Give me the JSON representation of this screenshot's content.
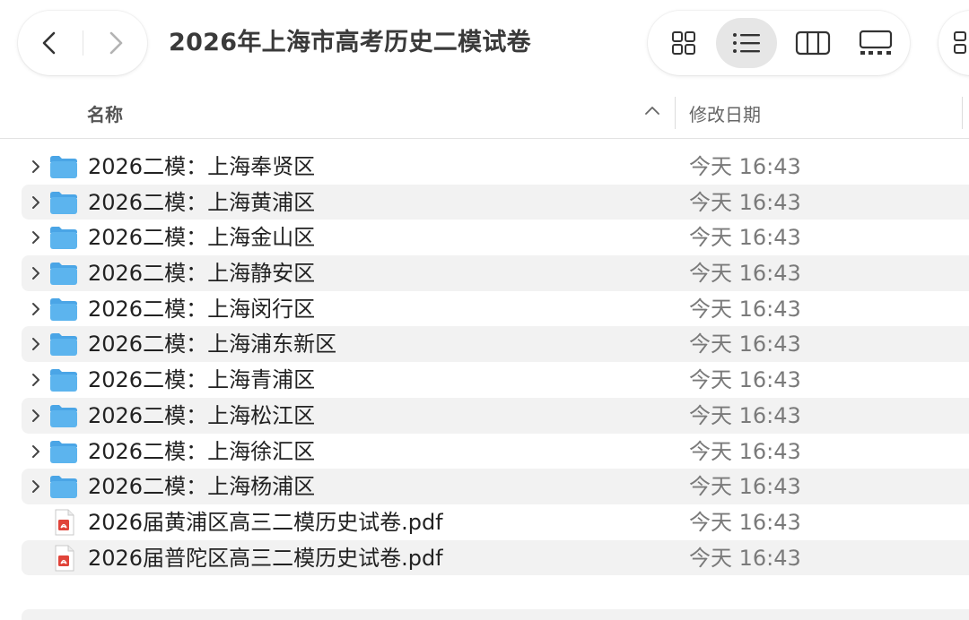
{
  "toolbar": {
    "title": "2026年上海市高考历史二模试卷",
    "back_icon": "chevron-left-icon",
    "forward_icon": "chevron-right-icon",
    "view_modes": [
      "icon-view",
      "list-view",
      "column-view",
      "gallery-view"
    ],
    "active_view": "list-view"
  },
  "columns": {
    "name": "名称",
    "date_modified": "修改日期",
    "sort_icon": "chevron-up-icon"
  },
  "files": [
    {
      "name": "2026二模：上海奉贤区",
      "date": "今天 16:43",
      "kind": "folder"
    },
    {
      "name": "2026二模：上海黄浦区",
      "date": "今天 16:43",
      "kind": "folder"
    },
    {
      "name": "2026二模：上海金山区",
      "date": "今天 16:43",
      "kind": "folder"
    },
    {
      "name": "2026二模：上海静安区",
      "date": "今天 16:43",
      "kind": "folder"
    },
    {
      "name": "2026二模：上海闵行区",
      "date": "今天 16:43",
      "kind": "folder"
    },
    {
      "name": "2026二模：上海浦东新区",
      "date": "今天 16:43",
      "kind": "folder"
    },
    {
      "name": "2026二模：上海青浦区",
      "date": "今天 16:43",
      "kind": "folder"
    },
    {
      "name": "2026二模：上海松江区",
      "date": "今天 16:43",
      "kind": "folder"
    },
    {
      "name": "2026二模：上海徐汇区",
      "date": "今天 16:43",
      "kind": "folder"
    },
    {
      "name": "2026二模：上海杨浦区",
      "date": "今天 16:43",
      "kind": "folder"
    },
    {
      "name": "2026届黄浦区高三二模历史试卷.pdf",
      "date": "今天 16:43",
      "kind": "pdf"
    },
    {
      "name": "2026届普陀区高三二模历史试卷.pdf",
      "date": "今天 16:43",
      "kind": "pdf"
    }
  ],
  "colors": {
    "folder": "#5cb4ee",
    "folder_tab": "#4aa5e6",
    "pdf": "#e0443a",
    "row_alt": "#f2f2f2"
  }
}
